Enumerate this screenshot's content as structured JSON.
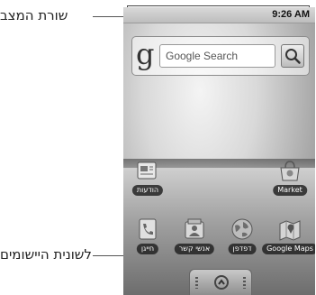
{
  "callouts": {
    "status_bar": "שורת המצב",
    "launcher_tab": "לשונית היישומים"
  },
  "status_bar": {
    "time": "9:26 AM"
  },
  "search_widget": {
    "logo": "g",
    "placeholder": "Google Search",
    "button_icon": "search-icon"
  },
  "apps": {
    "row1": [
      {
        "label": "הודעות",
        "icon": "messaging-icon"
      },
      {
        "label": "Market",
        "icon": "market-bag-icon"
      }
    ],
    "row2": [
      {
        "label": "חייגן",
        "icon": "dialer-icon"
      },
      {
        "label": "אנשי קשר",
        "icon": "contacts-icon"
      },
      {
        "label": "דפדפן",
        "icon": "browser-globe-icon"
      },
      {
        "label": "Google Maps",
        "icon": "maps-icon"
      }
    ]
  },
  "launcher_tab": {
    "icon": "chevron-up-icon"
  }
}
